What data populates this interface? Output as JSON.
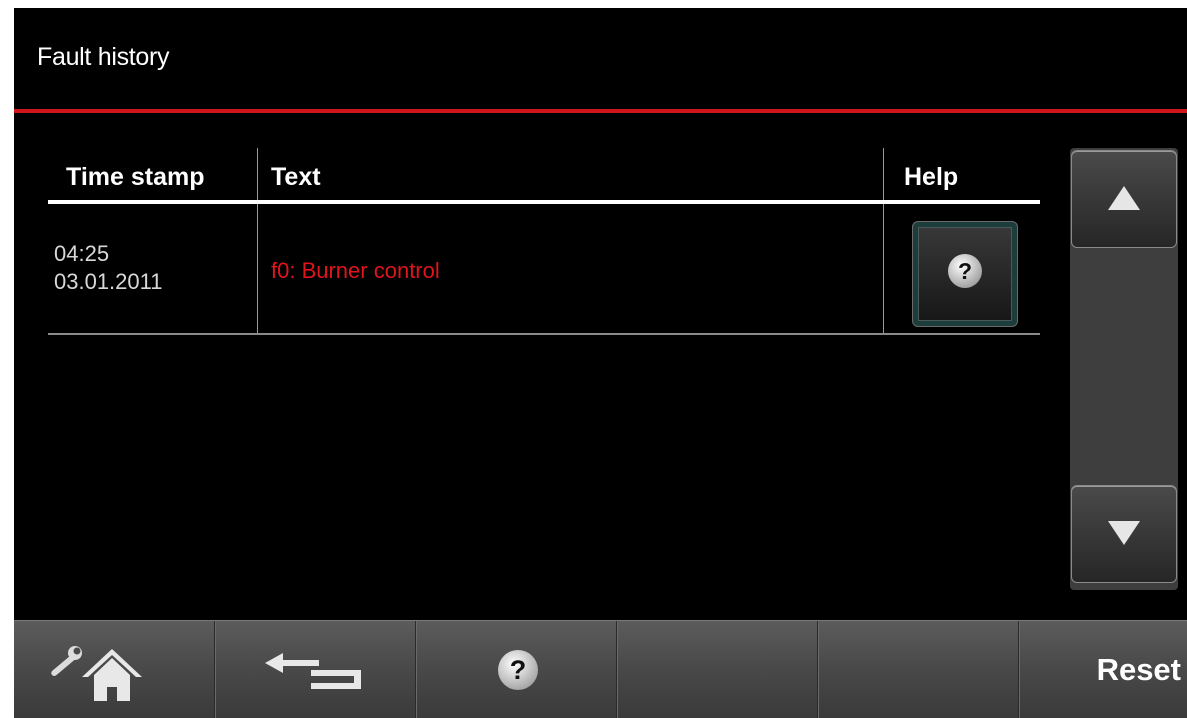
{
  "header": {
    "title": "Fault history"
  },
  "table": {
    "columns": [
      "Time stamp",
      "Text",
      "Help"
    ],
    "rows": [
      {
        "time": "04:25",
        "date": "03.01.2011",
        "text": "f0: Burner control",
        "help_icon": "question-icon"
      }
    ]
  },
  "scroll": {
    "up_icon": "triangle-up-icon",
    "down_icon": "triangle-down-icon"
  },
  "footer": {
    "buttons": [
      {
        "icon": "wrench-home-icon"
      },
      {
        "icon": "back-arrow-icon"
      },
      {
        "icon": "question-icon"
      },
      {
        "icon": ""
      },
      {
        "icon": ""
      }
    ],
    "reset_label": "Reset"
  },
  "colors": {
    "accent_red": "#d0141c",
    "fault_text": "#e0141c"
  }
}
